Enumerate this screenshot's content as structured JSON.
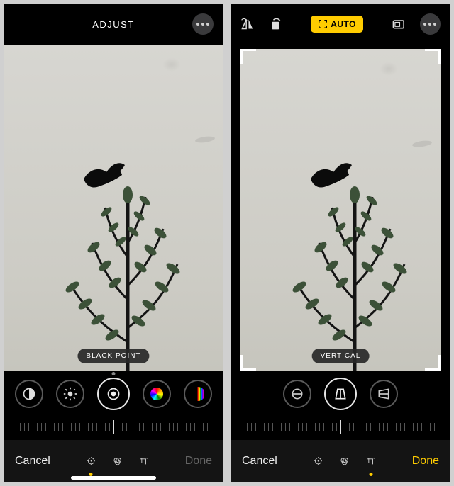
{
  "left": {
    "header_title": "ADJUST",
    "param_label": "BLACK POINT",
    "bottom": {
      "cancel": "Cancel",
      "done": "Done"
    }
  },
  "right": {
    "auto_label": "AUTO",
    "param_label": "VERTICAL",
    "bottom": {
      "cancel": "Cancel",
      "done": "Done"
    }
  },
  "colors": {
    "accent": "#ffcc00",
    "bg": "#000000",
    "panel": "#141414"
  }
}
